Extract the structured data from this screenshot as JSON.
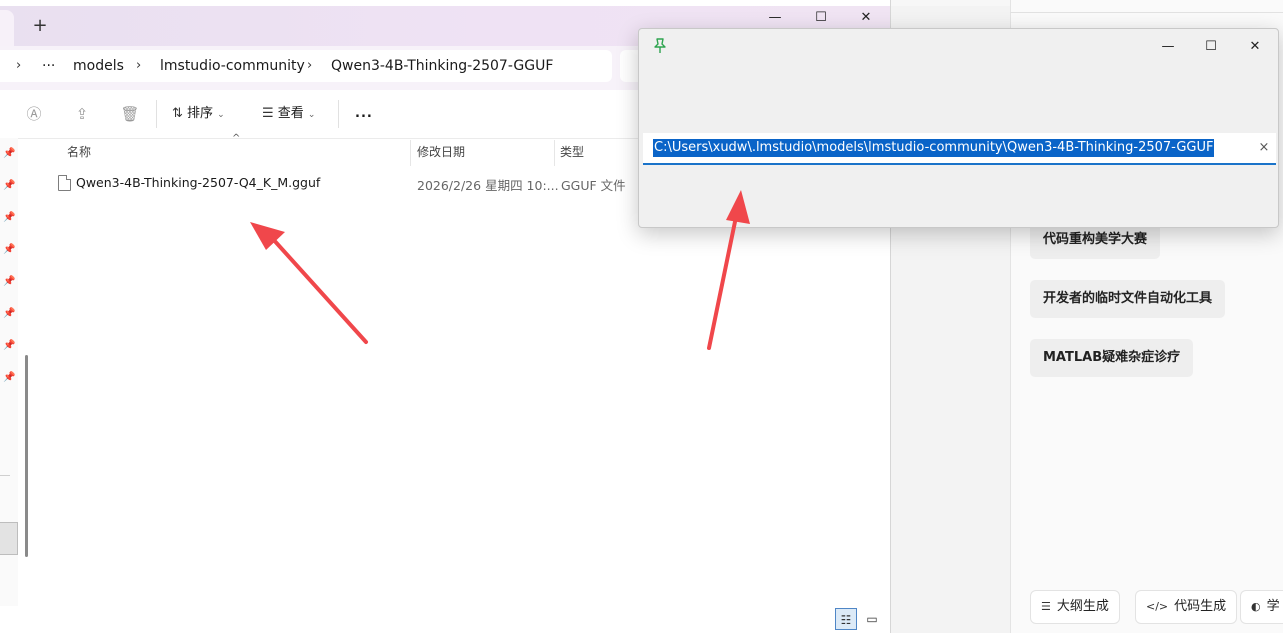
{
  "explorer": {
    "breadcrumbs": [
      "models",
      "lmstudio-community",
      "Qwen3-4B-Thinking-2507-GGUF"
    ],
    "toolbar": {
      "sort_label": "排序",
      "view_label": "查看",
      "more_label": "..."
    },
    "columns": {
      "name": "名称",
      "date": "修改日期",
      "type": "类型"
    },
    "files": [
      {
        "name": "Qwen3-4B-Thinking-2507-Q4_K_M.gguf",
        "date": "2026/2/26 星期四 10:...",
        "type": "GGUF 文件"
      }
    ]
  },
  "popup": {
    "path_value": "C:\\Users\\xudw\\.lmstudio\\models\\lmstudio-community\\Qwen3-4B-Thinking-2507-GGUF",
    "clear_glyph": "×"
  },
  "right_app": {
    "chips": [
      "代码重构美学大赛",
      "开发者的临时文件自动化工具",
      "MATLAB疑难杂症诊疗"
    ],
    "tools": [
      {
        "label": "大纲生成",
        "icon": "list-icon"
      },
      {
        "label": "代码生成",
        "icon": "code-icon"
      },
      {
        "label": "学",
        "icon": "graduation-icon"
      }
    ]
  },
  "colors": {
    "accent_blue": "#1a73c9",
    "selection_blue": "#0a64c8",
    "pin_green": "#2ea44f",
    "arrow_red": "#f0474b"
  }
}
